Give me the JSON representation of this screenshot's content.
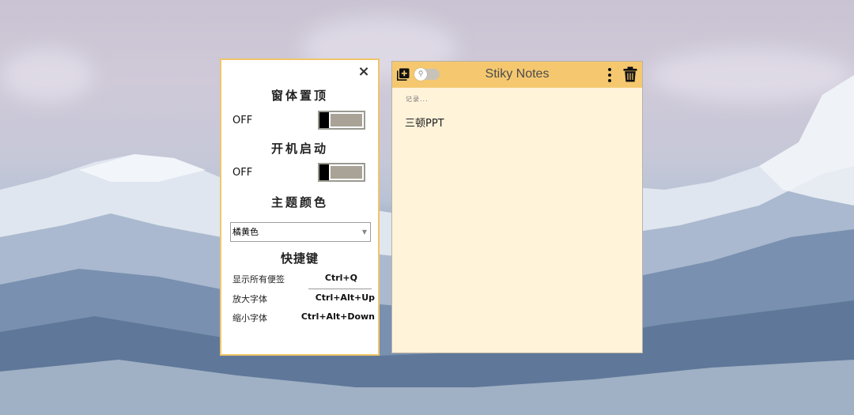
{
  "settings": {
    "close_label": "×",
    "window_top_title": "窗体置顶",
    "window_top_state": "OFF",
    "autostart_title": "开机启动",
    "autostart_state": "OFF",
    "theme_title": "主题颜色",
    "theme_selected": "橘黄色",
    "hotkeys_title": "快捷键",
    "hotkeys": [
      {
        "name": "显示所有便签",
        "key": "Ctrl+Q"
      },
      {
        "name": "放大字体",
        "key": "Ctrl+Alt+Up"
      },
      {
        "name": "缩小字体",
        "key": "Ctrl+Alt+Down"
      }
    ]
  },
  "note": {
    "title": "Stiky Notes",
    "placeholder": "记录...",
    "content": "三顿PPT",
    "header_color": "#f5c870",
    "body_color": "#fff3da",
    "icons": [
      "add-note-icon",
      "pin-icon",
      "more-vertical-icon",
      "trash-icon"
    ]
  },
  "theme": {
    "accent": "#f0c56a"
  }
}
